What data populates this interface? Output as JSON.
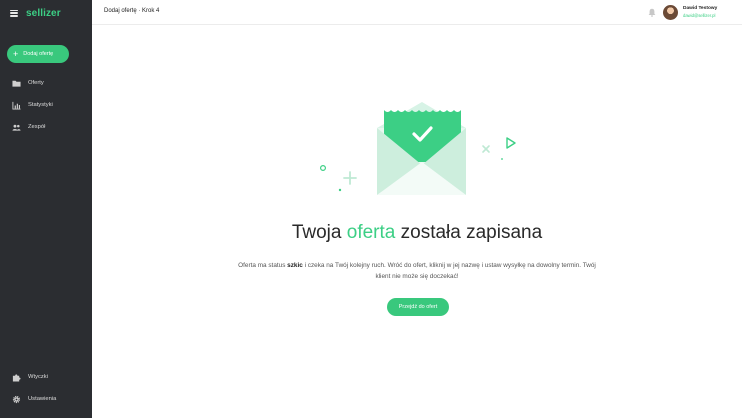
{
  "app": {
    "logo_text": "sellizer"
  },
  "sidebar": {
    "add_button_label": "Dodaj ofertę",
    "items": [
      {
        "label": "Oferty",
        "icon": "folder-icon"
      },
      {
        "label": "Statystyki",
        "icon": "bar-chart-icon"
      },
      {
        "label": "Zespół",
        "icon": "people-icon"
      }
    ],
    "bottom_items": [
      {
        "label": "Wtyczki",
        "icon": "puzzle-icon"
      },
      {
        "label": "Ustawienia",
        "icon": "gear-icon"
      }
    ]
  },
  "header": {
    "breadcrumb": "Dodaj ofertę · Krok 4",
    "user_name": "Dawid Testowy",
    "user_email": "dawid@sellizer.pl"
  },
  "main": {
    "headline_before": "Twoja ",
    "headline_accent": "oferta",
    "headline_after": " została zapisana",
    "desc_before": "Oferta ma status ",
    "desc_status": "szkic",
    "desc_after": " i czeka na Twój kolejny ruch. Wróć do ofert, kliknij w jej nazwę i ustaw wysyłkę na dowolny termin. Twój klient nie może się doczekać!",
    "cta_label": "Przejdź do ofert"
  },
  "colors": {
    "accent": "#3ccf85",
    "button": "#39c87d",
    "sidebar_bg": "#2b2d31"
  }
}
